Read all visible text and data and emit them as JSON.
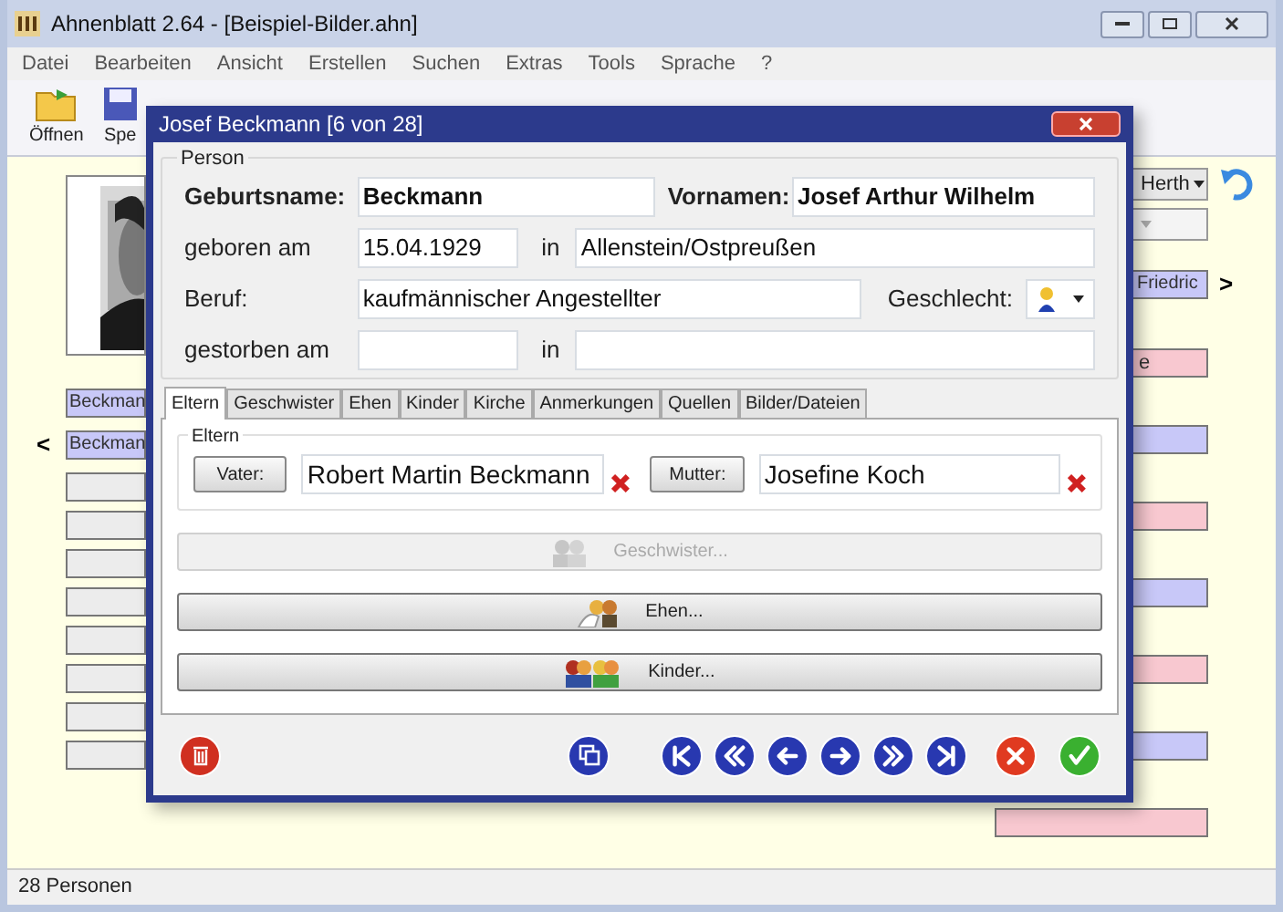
{
  "window": {
    "title": "Ahnenblatt 2.64 - [Beispiel-Bilder.ahn]"
  },
  "menu": [
    "Datei",
    "Bearbeiten",
    "Ansicht",
    "Erstellen",
    "Suchen",
    "Extras",
    "Tools",
    "Sprache",
    "?"
  ],
  "toolbar": [
    {
      "label": "Öffnen",
      "kind": "open"
    },
    {
      "label": "Spe",
      "kind": "save"
    }
  ],
  "left_panel": {
    "rows": [
      {
        "text": "Beckman",
        "color": "#c8c8f8",
        "marker": ""
      },
      {
        "text": "Beckman",
        "color": "#c8c8f8",
        "marker": "<"
      },
      {
        "text": "",
        "color": "#ececec",
        "marker": ""
      },
      {
        "text": "",
        "color": "#ececec",
        "marker": ""
      },
      {
        "text": "",
        "color": "#ececec",
        "marker": ""
      },
      {
        "text": "",
        "color": "#ececec",
        "marker": ""
      },
      {
        "text": "",
        "color": "#ececec",
        "marker": ""
      },
      {
        "text": "",
        "color": "#ececec",
        "marker": ""
      },
      {
        "text": "",
        "color": "#ececec",
        "marker": ""
      },
      {
        "text": "",
        "color": "#ececec",
        "marker": ""
      }
    ]
  },
  "right_panel": {
    "combos": [
      {
        "value": "Herth",
        "disabled": false
      },
      {
        "disabled": true
      }
    ],
    "partner": {
      "text": "Friedric",
      "marker": ">"
    },
    "rows": [
      {
        "text": "e",
        "color": "#f8c8d0"
      },
      {
        "text": "",
        "color": "#c8c8f8"
      },
      {
        "text": "",
        "color": "#f8c8d0"
      },
      {
        "text": "",
        "color": "#c8c8f8"
      },
      {
        "text": "",
        "color": "#f8c8d0"
      },
      {
        "text": "",
        "color": "#c8c8f8"
      },
      {
        "text": "",
        "color": "#f8c8d0"
      }
    ]
  },
  "dialog": {
    "title": "Josef Beckmann [6 von 28]",
    "person": {
      "label": "Person",
      "birth_name": {
        "label": "Geburtsname:",
        "value": "Beckmann"
      },
      "given_names": {
        "label": "Vornamen:",
        "value": "Josef Arthur Wilhelm"
      },
      "born": {
        "label": "geboren am",
        "date": "15.04.1929",
        "in_label": "in",
        "place": "Allenstein/Ostpreußen"
      },
      "occupation": {
        "label": "Beruf:",
        "value": "kaufmännischer Angestellter"
      },
      "gender": {
        "label": "Geschlecht:"
      },
      "died": {
        "label": "gestorben am",
        "in_label": "in"
      }
    },
    "tabs": [
      {
        "label": "Eltern",
        "selected": true
      },
      {
        "label": "Geschwister",
        "selected": false
      },
      {
        "label": "Ehen",
        "selected": false
      },
      {
        "label": "Kinder",
        "selected": false
      },
      {
        "label": "Kirche",
        "selected": false
      },
      {
        "label": "Anmerkungen",
        "selected": false
      },
      {
        "label": "Quellen",
        "selected": false
      },
      {
        "label": "Bilder/Dateien",
        "selected": false
      }
    ],
    "parents": {
      "label": "Eltern",
      "father_button": "Vater:",
      "father": "Robert Martin Beckmann",
      "mother_button": "Mutter:",
      "mother": "Josefine Koch"
    },
    "buttons": [
      {
        "label": "Geschwister...",
        "disabled": true,
        "kind": "siblings"
      },
      {
        "label": "Ehen...",
        "disabled": false,
        "kind": "marriages"
      },
      {
        "label": "Kinder...",
        "disabled": false,
        "kind": "children"
      }
    ]
  },
  "status_bar": "28 Personen"
}
